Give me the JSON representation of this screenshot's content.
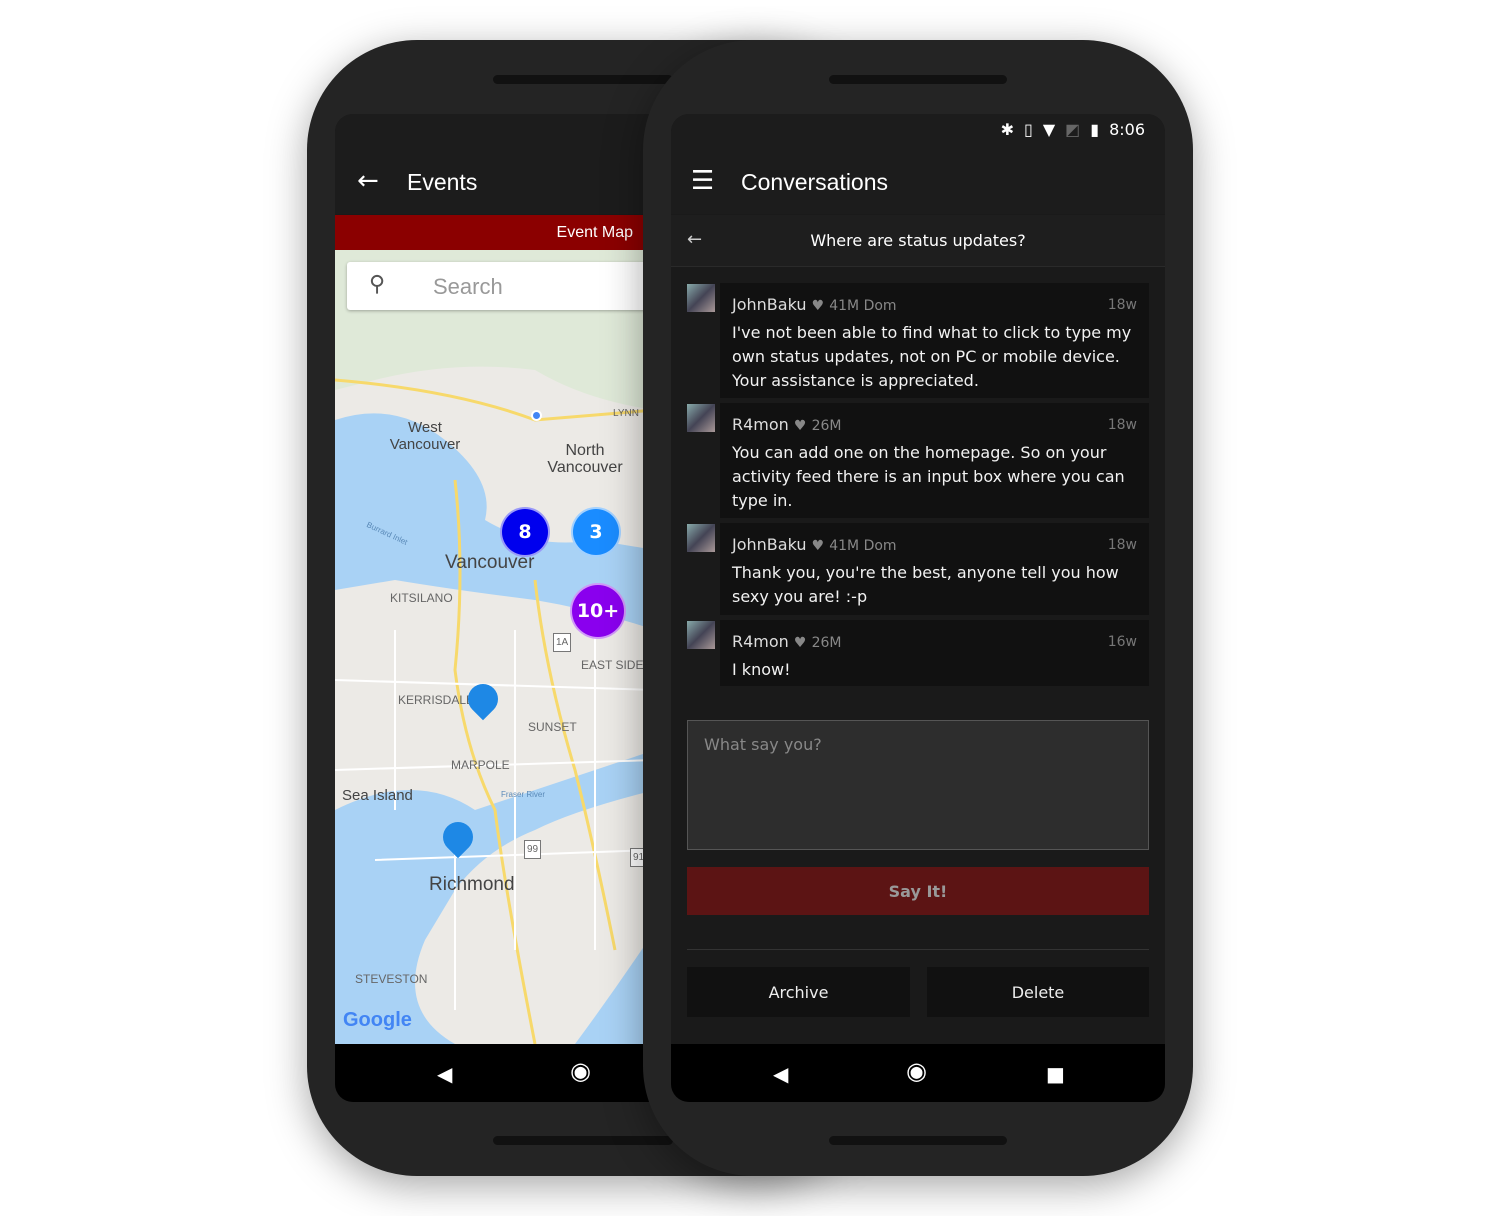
{
  "events_screen": {
    "title": "Events",
    "tab": "Event Map",
    "search_placeholder": "Search",
    "map_labels": {
      "west_vancouver": "West Vancouver",
      "north_vancouver": "North Vancouver",
      "vancouver": "Vancouver",
      "kitsilano": "KITSILANO",
      "kerrisdale": "KERRISDALE",
      "sunset": "SUNSET",
      "marpole": "MARPOLE",
      "sea_island": "Sea Island",
      "richmond": "Richmond",
      "steveston": "STEVESTON",
      "east_side": "EAST SIDE",
      "lynn": "LYNN",
      "burrard_inlet": "Burrard Inlet",
      "fraser_river": "Fraser River",
      "hwy_1a": "1A",
      "hwy_99": "99",
      "hwy_91": "91",
      "google": "Google"
    },
    "clusters": [
      {
        "label": "8",
        "color": "#0000ee"
      },
      {
        "label": "3",
        "color": "#1a8cff"
      },
      {
        "label": "10+",
        "color": "#8a00ee"
      }
    ],
    "accent": "#8b0000"
  },
  "conversations_screen": {
    "status_bar": {
      "time": "8:06",
      "icons": [
        "bluetooth-icon",
        "vibrate-icon",
        "wifi-icon",
        "no-sim-icon",
        "battery-icon"
      ]
    },
    "title": "Conversations",
    "subject": "Where are status updates?",
    "messages": [
      {
        "user": "JohnBaku",
        "meta": "41M Dom",
        "time": "18w",
        "text": "I've not been able to find what to click to type my own status updates, not on PC or mobile device. Your assistance is appreciated."
      },
      {
        "user": "R4mon",
        "meta": "26M",
        "time": "18w",
        "text": "You can add one on the homepage. So on your activity feed there is an input box where you can type in."
      },
      {
        "user": "JohnBaku",
        "meta": "41M Dom",
        "time": "18w",
        "text": "Thank you, you're the best, anyone tell you how sexy you are! :-p"
      },
      {
        "user": "R4mon",
        "meta": "26M",
        "time": "16w",
        "text": "I know!"
      }
    ],
    "reply_placeholder": "What say you?",
    "submit_label": "Say It!",
    "archive_label": "Archive",
    "delete_label": "Delete",
    "button_color": "#5c1414"
  }
}
